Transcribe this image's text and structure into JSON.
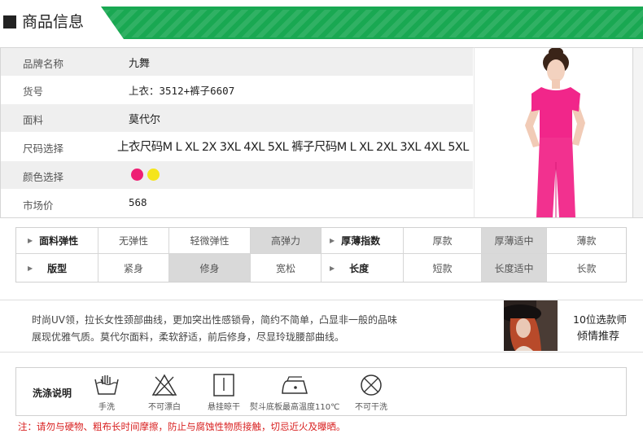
{
  "header": {
    "title": "商品信息"
  },
  "info": [
    {
      "label": "品牌名称",
      "value": "九舞"
    },
    {
      "label": "货号",
      "value": "上衣：3512+裤子6607"
    },
    {
      "label": "面料",
      "value": "莫代尔"
    },
    {
      "label": "尺码选择",
      "value": "上衣尺码M L XL 2X 3XL 4XL 5XL 裤子尺码M L XL 2XL 3XL 4XL 5XL"
    },
    {
      "label": "颜色选择",
      "colors": [
        "#ee1f74",
        "#f5e51c"
      ]
    },
    {
      "label": "市场价",
      "value": "568"
    }
  ],
  "attributes": {
    "row1": {
      "head1": "面料弹性",
      "opts1": [
        "无弹性",
        "轻微弹性",
        "高弹力"
      ],
      "selected1": 2,
      "head2": "厚薄指数",
      "opts2": [
        "厚款",
        "厚薄适中",
        "薄款"
      ],
      "selected2": 1
    },
    "row2": {
      "head1": "版型",
      "opts1": [
        "紧身",
        "修身",
        "宽松"
      ],
      "selected1": 1,
      "head2": "长度",
      "opts2": [
        "短款",
        "长度适中",
        "长款"
      ],
      "selected2": 1
    }
  },
  "designer": {
    "line1": "时尚UV领，拉长女性颈部曲线，更加突出性感锁骨，简约不简单，凸显非一般的品味",
    "line2": "展现优雅气质。莫代尔面料，柔软舒适，前后修身，尽显玲珑腰部曲线。",
    "rec_line1": "10位选款师",
    "rec_line2": "倾情推荐"
  },
  "wash": {
    "title": "洗涤说明",
    "items": [
      {
        "icon": "hand-wash-icon",
        "label": "手洗"
      },
      {
        "icon": "no-bleach-icon",
        "label": "不可漂白"
      },
      {
        "icon": "hang-dry-icon",
        "label": "悬挂晾干"
      },
      {
        "icon": "iron-110-icon",
        "label": "熨斗底板最高温度110℃"
      },
      {
        "icon": "no-dry-clean-icon",
        "label": "不可干洗"
      }
    ]
  },
  "warning": "注：请勿与硬物、粗布长时间摩擦，防止与腐蚀性物质接触，切忌近火及曝晒。",
  "colors": {
    "brand_green": "#19a852",
    "warning_red": "#d81e1e",
    "selected_cell": "#d9d9d9"
  }
}
